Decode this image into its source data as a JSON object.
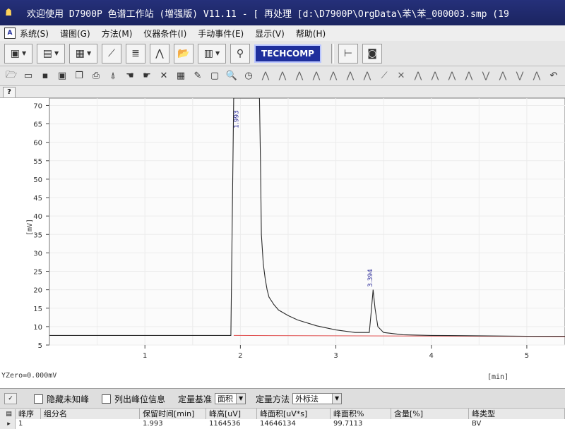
{
  "window": {
    "title": "欢迎使用 D7900P 色谱工作站 (增强版) V11.11 - [ 再处理 [d:\\D7900P\\OrgData\\苯\\苯_000003.smp (19"
  },
  "menu": {
    "items": [
      "系统(S)",
      "谱图(G)",
      "方法(M)",
      "仪器条件(I)",
      "手动事件(E)",
      "显示(V)",
      "帮助(H)"
    ]
  },
  "toolbar": {
    "techcomp_label": "TECHCOMP"
  },
  "help": {
    "label": "?"
  },
  "chart_data": {
    "type": "line",
    "xlabel": "[min]",
    "ylabel": "[mV]",
    "xlim": [
      0,
      5.4
    ],
    "ylim": [
      5,
      72
    ],
    "xticks": [
      1,
      2,
      3,
      4,
      5
    ],
    "yticks": [
      5,
      10,
      15,
      20,
      25,
      30,
      35,
      40,
      45,
      50,
      55,
      60,
      65,
      70
    ],
    "yzero_label": "YZero=0.000mV",
    "peaks": [
      {
        "rt": 1.993,
        "label": "1.993"
      },
      {
        "rt": 3.394,
        "label": "3.394"
      }
    ],
    "series": [
      {
        "x": [
          0.0,
          1.9,
          1.93,
          2.2,
          2.21,
          2.22,
          2.24,
          2.26,
          2.28,
          2.3,
          2.35,
          2.4,
          2.5,
          2.6,
          2.8,
          3.0,
          3.2,
          3.35,
          3.37,
          3.39,
          3.41,
          3.44,
          3.5,
          3.7,
          4.0,
          4.5,
          5.0,
          5.4
        ],
        "y": [
          7.6,
          7.6,
          72,
          72,
          55,
          35,
          27,
          23,
          20,
          18,
          16,
          14.5,
          13,
          11.8,
          10.2,
          9.1,
          8.4,
          8.4,
          14,
          20,
          15,
          10,
          8.4,
          7.8,
          7.6,
          7.5,
          7.4,
          7.4
        ]
      }
    ],
    "colors": {
      "trace": "#2a2a2a",
      "baseline": "#e05050",
      "peak_label": "#2d2d9a"
    }
  },
  "options": {
    "hide_unknown_label": "隐藏未知峰",
    "list_peak_info_label": "列出峰位信息",
    "quant_basis_label": "定量基准",
    "quant_basis_value": "面积",
    "quant_method_label": "定量方法",
    "quant_method_value": "外标法"
  },
  "table": {
    "headers": [
      "峰序",
      "组分名",
      "保留时间[min]",
      "峰高[uV]",
      "峰面积[uV*s]",
      "峰面积%",
      "含量[%]",
      "峰类型"
    ],
    "rows": [
      [
        "1",
        "",
        "1.993",
        "1164536",
        "14646134",
        "99.7113",
        "",
        "BV"
      ]
    ]
  }
}
